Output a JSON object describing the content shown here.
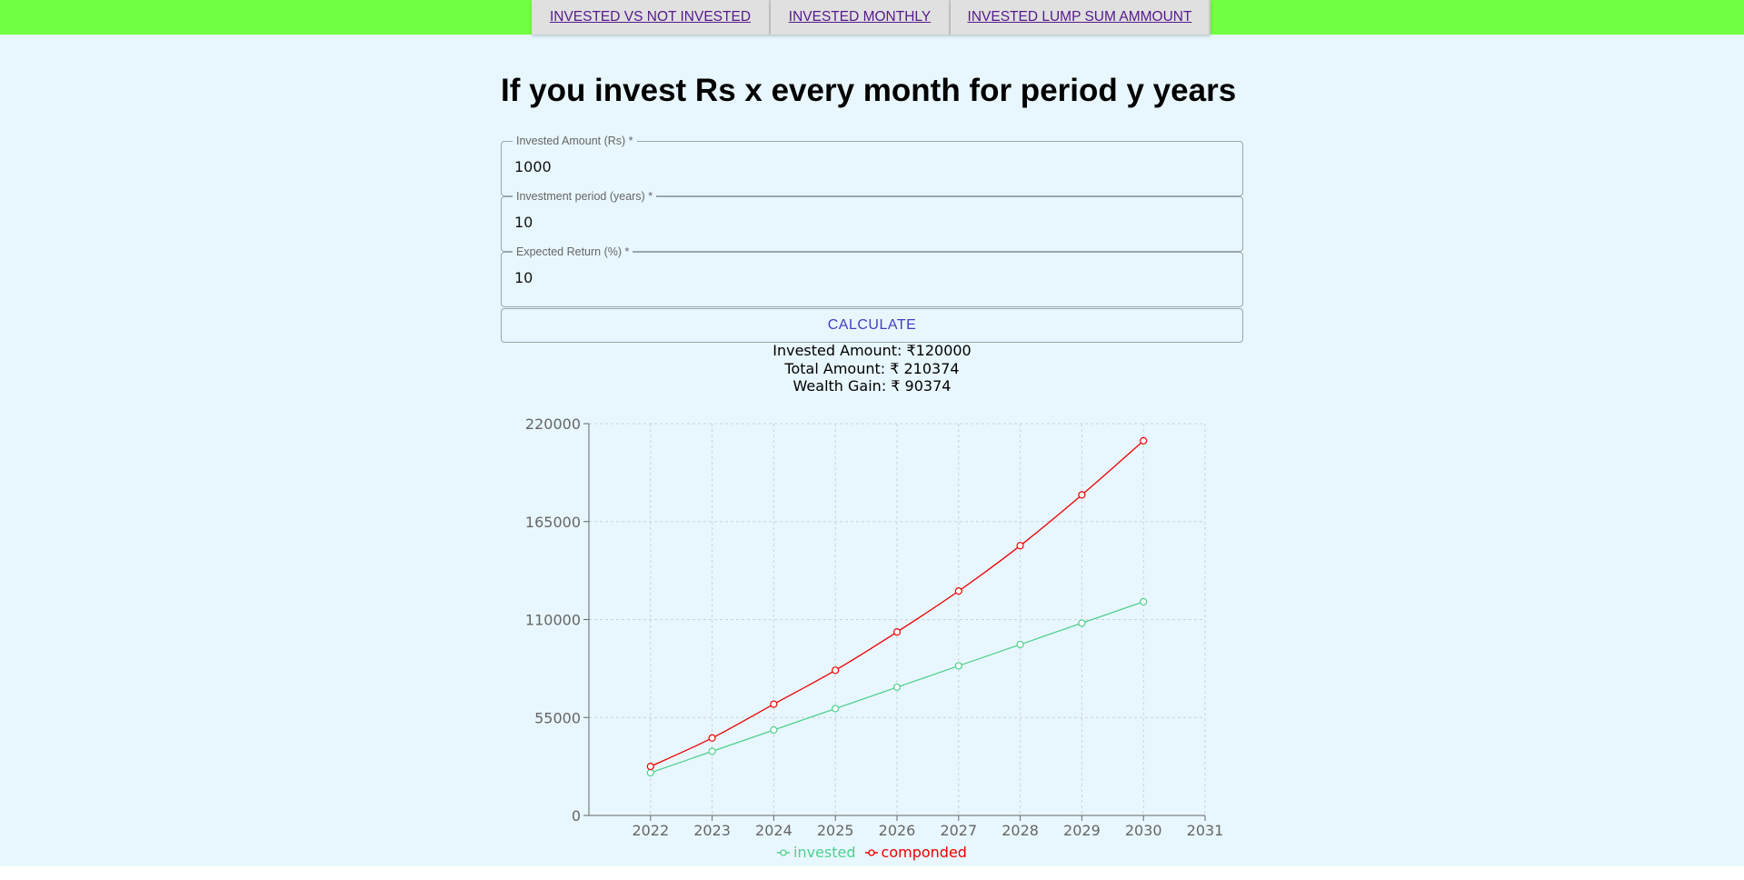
{
  "nav": {
    "tabs": [
      {
        "label": "INVESTED VS NOT INVESTED"
      },
      {
        "label": "INVESTED MONTHLY"
      },
      {
        "label": "INVESTED LUMP SUM AMMOUNT"
      }
    ]
  },
  "page_title": "If you invest Rs x every month for period y years",
  "form": {
    "amount": {
      "label": "Invested Amount (Rs) *",
      "value": "1000"
    },
    "period": {
      "label": "Investment period (years) *",
      "value": "10"
    },
    "return": {
      "label": "Expected Return (%) *",
      "value": "10"
    },
    "calculate_label": "CALCULATE"
  },
  "results": {
    "invested": "Invested Amount: ₹120000",
    "total": "Total Amount: ₹ 210374",
    "gain": "Wealth Gain: ₹ 90374"
  },
  "colors": {
    "topbar": "#70ff42",
    "background": "#e8f7fd",
    "invested": "#4fd08f",
    "componded": "#ee0000"
  },
  "chart_data": {
    "type": "line",
    "categories": [
      "2022",
      "2023",
      "2024",
      "2025",
      "2026",
      "2027",
      "2028",
      "2029",
      "2030",
      "2031"
    ],
    "series": [
      {
        "name": "invested",
        "color": "#4fd08f",
        "values": [
          24000,
          36000,
          48000,
          60000,
          72000,
          84000,
          96000,
          108000,
          120000
        ]
      },
      {
        "name": "componded",
        "color": "#ee0000",
        "values": [
          27500,
          43500,
          62500,
          81500,
          103000,
          126000,
          151500,
          180000,
          210374
        ]
      }
    ],
    "yticks": [
      "0",
      "55000",
      "110000",
      "165000",
      "220000"
    ],
    "ylim": [
      0,
      220000
    ],
    "grid": true,
    "legend_position": "bottom-center"
  }
}
